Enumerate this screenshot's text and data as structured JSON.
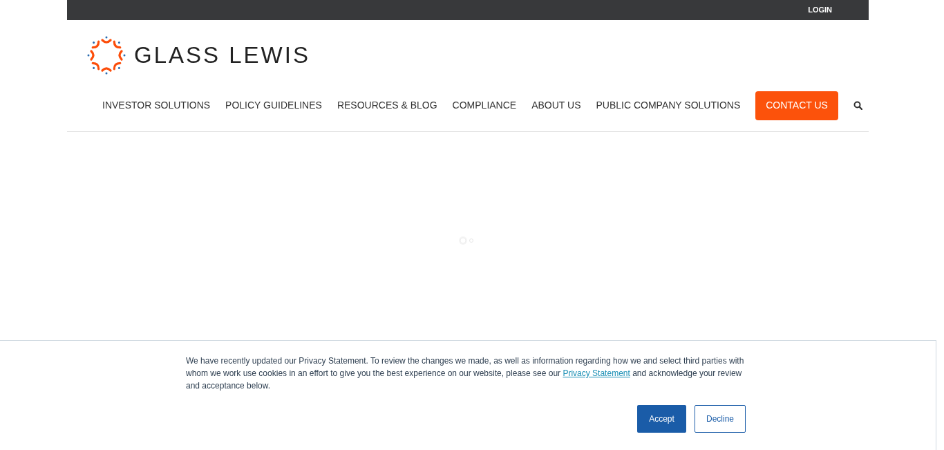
{
  "top_bar": {
    "login": "LOGIN"
  },
  "logo": {
    "text": "GLASS LEWIS"
  },
  "nav": {
    "items": [
      {
        "label": "INVESTOR SOLUTIONS"
      },
      {
        "label": "POLICY GUIDELINES"
      },
      {
        "label": "RESOURCES & BLOG"
      },
      {
        "label": "COMPLIANCE"
      },
      {
        "label": "ABOUT US"
      },
      {
        "label": "PUBLIC COMPANY SOLUTIONS"
      }
    ],
    "cta": "CONTACT US"
  },
  "cookie_banner": {
    "text_before": "We have recently updated our Privacy Statement. To review the changes we made, as well as information regarding how we and select third parties with whom we work use cookies in an effort to give you the best experience on our website, please see our",
    "link": "Privacy Statement",
    "text_after": "and acknowledge your review and acceptance below.",
    "buttons": [
      {
        "label": "Accept",
        "kind": "primary"
      },
      {
        "label": "Decline",
        "kind": "secondary"
      }
    ]
  }
}
